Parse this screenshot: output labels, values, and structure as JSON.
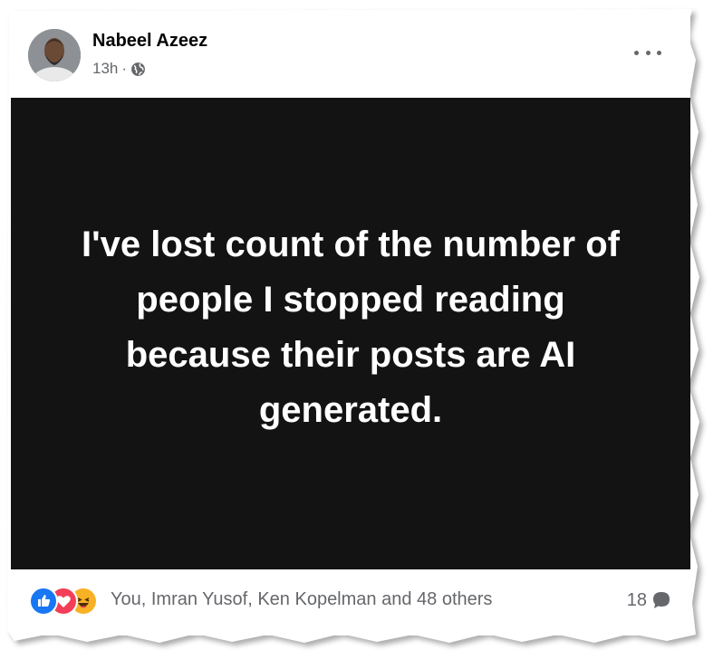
{
  "post": {
    "author": "Nabeel Azeez",
    "time": "13h",
    "separator": "·",
    "text": "I've lost count of the number of people I stopped reading because their posts are AI generated."
  },
  "icons": {
    "audience": "globe-icon",
    "menu": "more-options-icon",
    "reactions": [
      "like-icon",
      "love-icon",
      "haha-icon"
    ],
    "comments": "comment-icon"
  },
  "footer": {
    "reacted_by": "You, Imran Yusof, Ken Kopelman and 48 others",
    "comment_count": "18"
  },
  "colors": {
    "post_background": "#131313",
    "post_text": "#ffffff",
    "like": "#1877f2",
    "love": "#f33e58",
    "haha": "#f7b125",
    "secondary_text": "#65676b"
  }
}
